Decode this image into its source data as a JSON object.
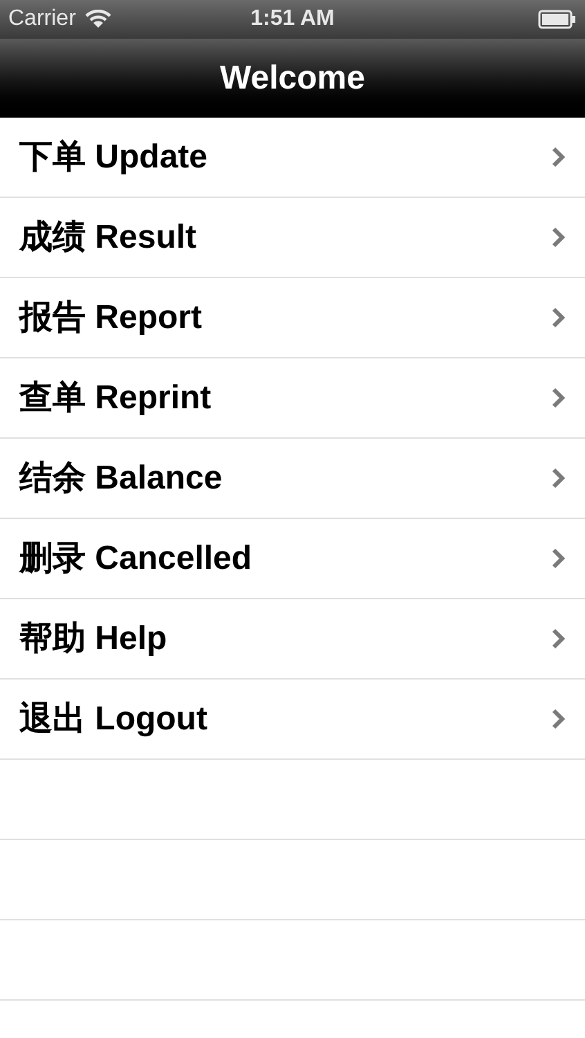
{
  "status_bar": {
    "carrier": "Carrier",
    "time": "1:51 AM"
  },
  "nav_bar": {
    "title": "Welcome"
  },
  "menu": [
    {
      "label": "下单 Update"
    },
    {
      "label": "成绩 Result"
    },
    {
      "label": "报告 Report"
    },
    {
      "label": "查单 Reprint"
    },
    {
      "label": "结余 Balance"
    },
    {
      "label": "删录 Cancelled"
    },
    {
      "label": "帮助 Help"
    },
    {
      "label": "退出 Logout"
    }
  ]
}
